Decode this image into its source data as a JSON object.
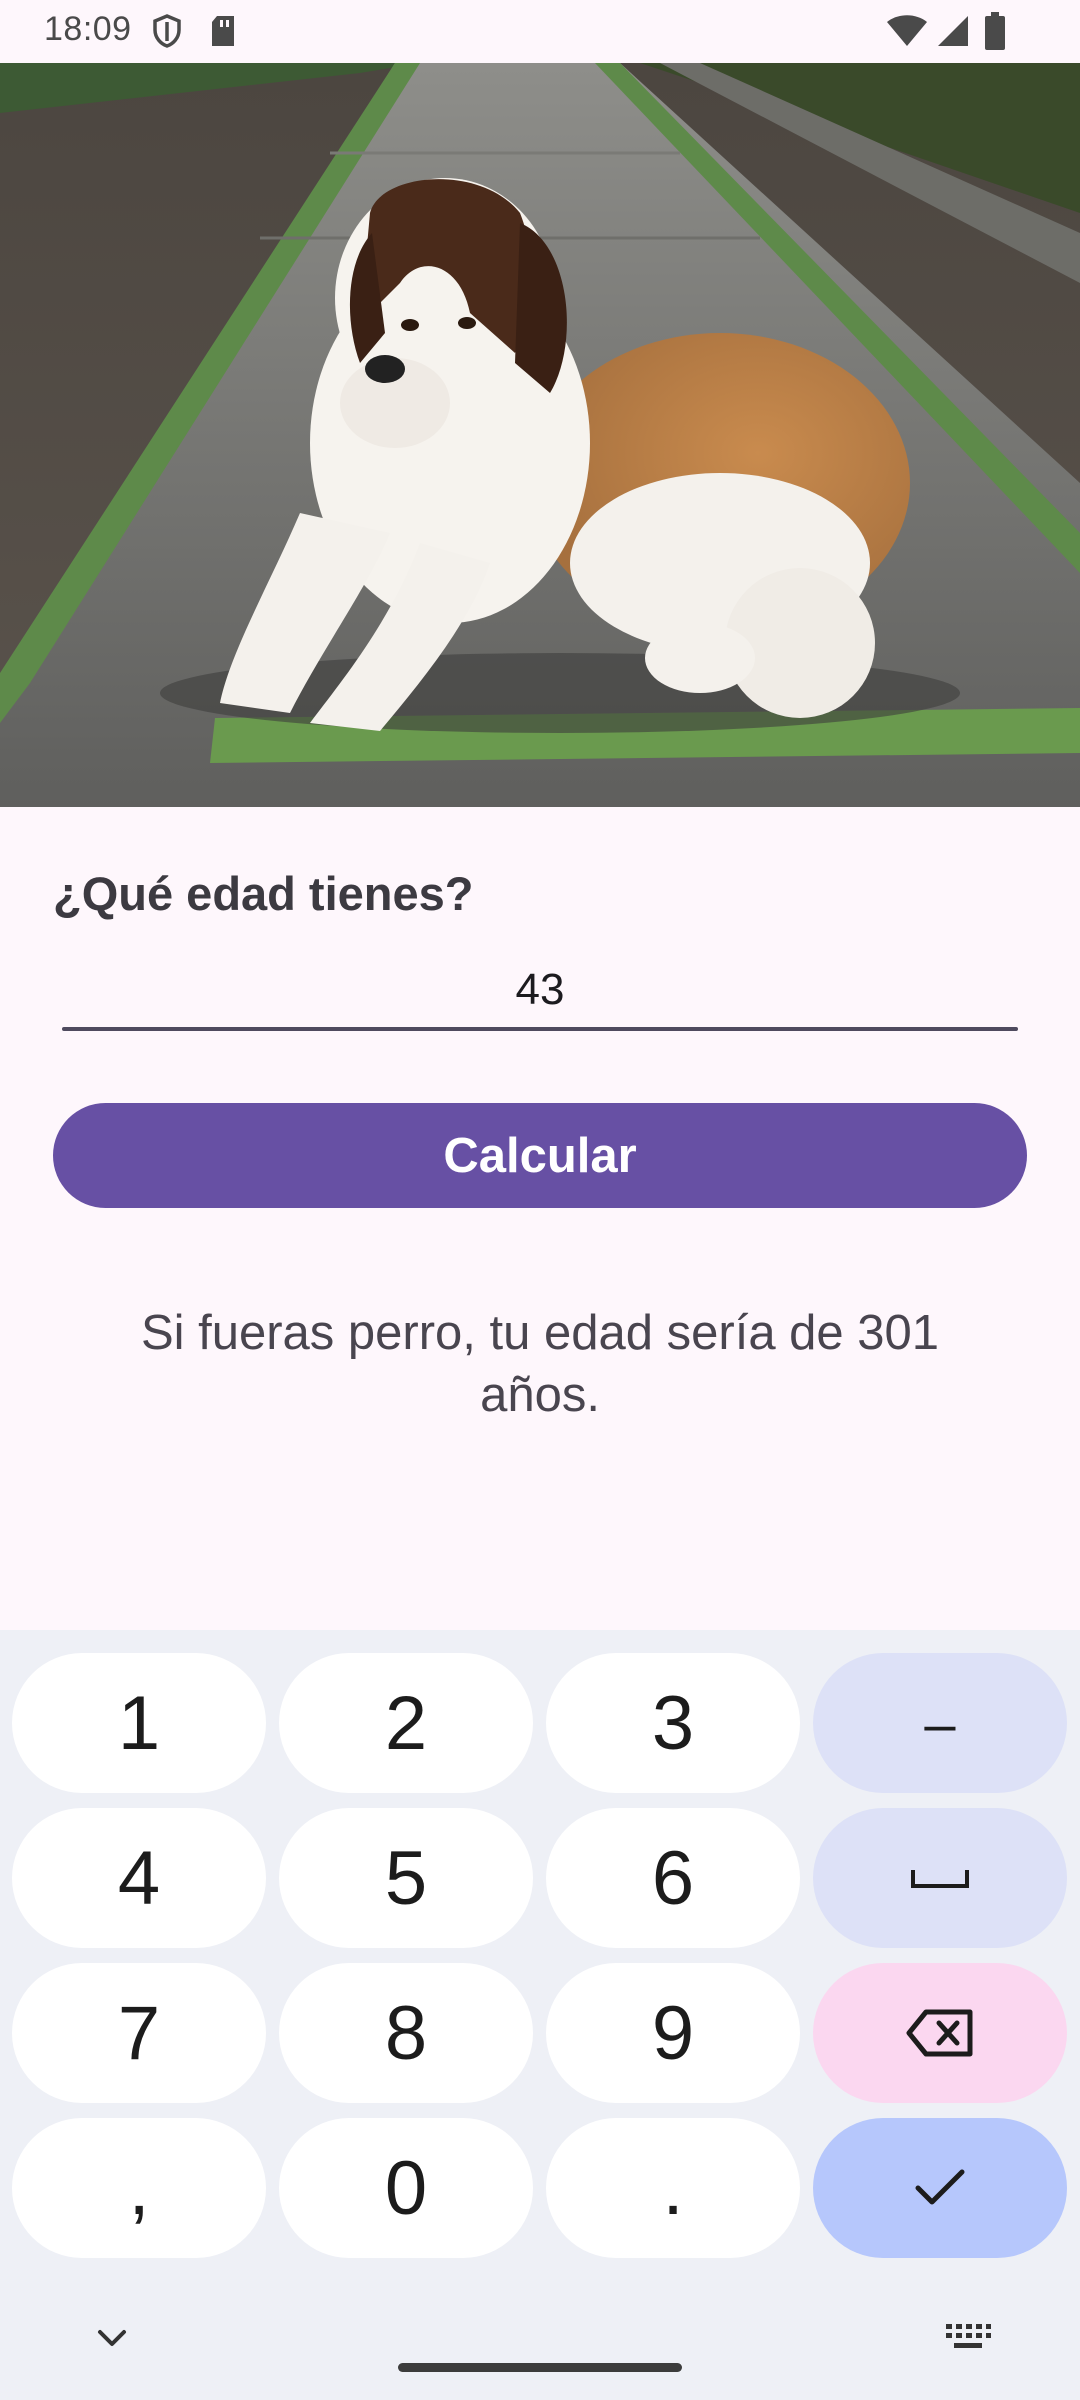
{
  "status_bar": {
    "time": "18:09",
    "icons": [
      "shield-icon",
      "sd-card-icon",
      "wifi-icon",
      "signal-icon",
      "battery-icon"
    ]
  },
  "form": {
    "question": "¿Qué edad tienes?",
    "age_value": "43",
    "calculate_label": "Calcular",
    "result_text": "Si fueras perro, tu edad sería de 301 años."
  },
  "keyboard": {
    "keys": [
      "1",
      "2",
      "3",
      "–",
      "4",
      "5",
      "6",
      "space",
      "7",
      "8",
      "9",
      "backspace",
      ",",
      "0",
      ".",
      "done"
    ],
    "labels": {
      "k1": "1",
      "k2": "2",
      "k3": "3",
      "dash": "–",
      "k4": "4",
      "k5": "5",
      "k6": "6",
      "k7": "7",
      "k8": "8",
      "k9": "9",
      "comma": ",",
      "k0": "0",
      "period": "."
    }
  },
  "colors": {
    "accent": "#6750a4",
    "background": "#fef7fc",
    "keyboard_bg": "#eef0f6",
    "function_key": "#dde1f7",
    "delete_key": "#fbd7f0",
    "enter_key": "#b6c7fc"
  }
}
